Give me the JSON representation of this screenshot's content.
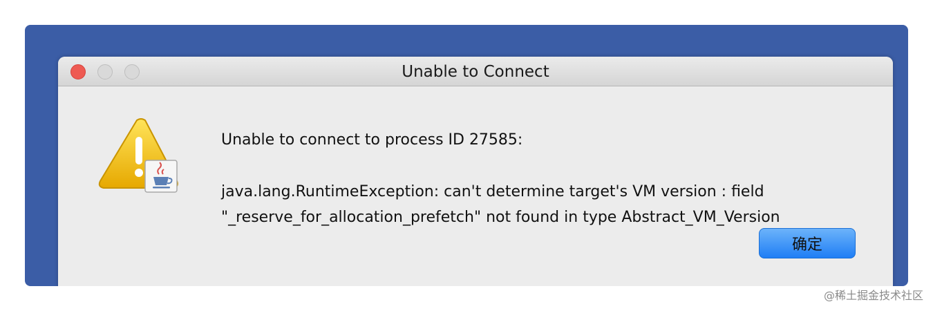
{
  "window": {
    "title": "Unable to Connect"
  },
  "message": {
    "heading": "Unable to connect to process ID 27585:",
    "detail_line1": "java.lang.RuntimeException: can't determine target's VM version : field",
    "detail_line2": "\"_reserve_for_allocation_prefetch\" not found in type Abstract_VM_Version"
  },
  "buttons": {
    "ok_label": "确定"
  },
  "icons": {
    "alert": "warning-triangle-icon",
    "badge": "java-coffee-cup-icon"
  },
  "watermark": "@稀土掘金技术社区",
  "colors": {
    "frame_background": "#3b5da6",
    "dialog_background": "#ececec",
    "close_button": "#ee5a52",
    "ok_button": "#1f7ef5",
    "warning": "#f5c400"
  }
}
